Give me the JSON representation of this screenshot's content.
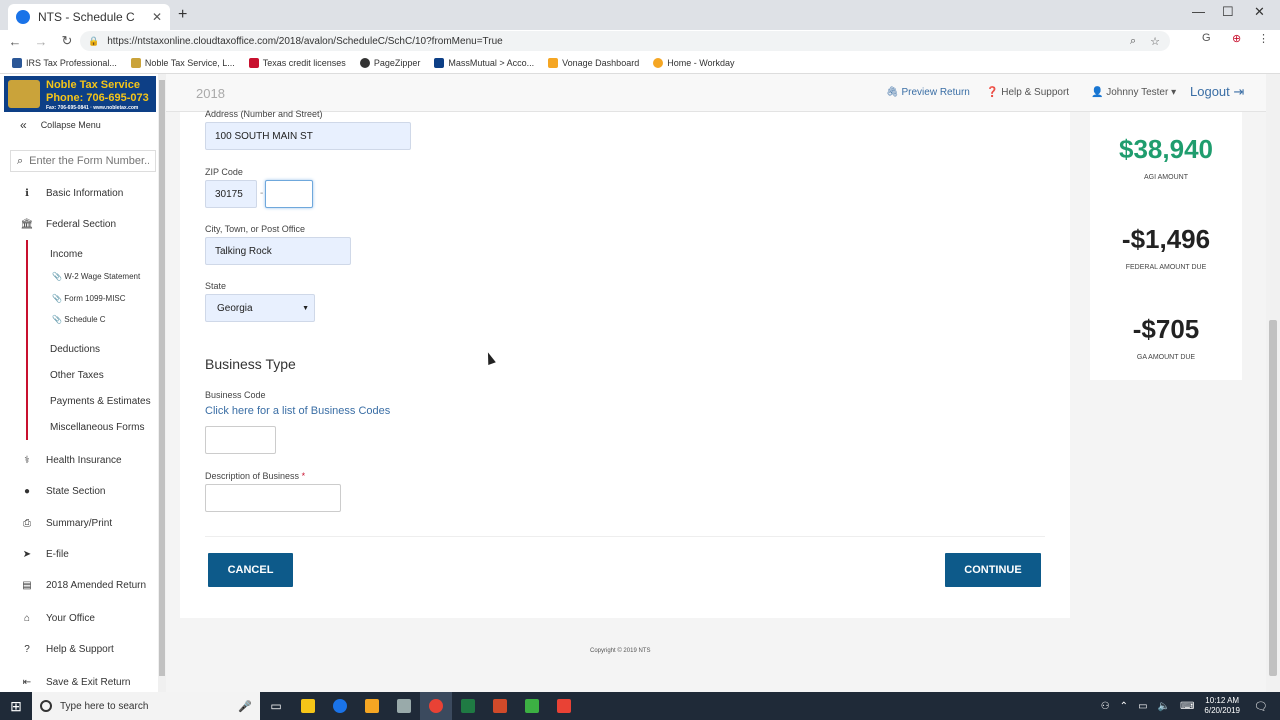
{
  "browser": {
    "tab_title": "NTS - Schedule C",
    "url": "https://ntstaxonline.cloudtaxoffice.com/2018/avalon/ScheduleC/SchC/10?fromMenu=True",
    "bookmarks": [
      {
        "label": "IRS Tax Professional...",
        "color": "#2b5797"
      },
      {
        "label": "Noble Tax Service, L...",
        "color": "#caa33a"
      },
      {
        "label": "Texas credit licenses",
        "color": "#c8102e"
      },
      {
        "label": "PageZipper",
        "color": "#333333"
      },
      {
        "label": "MassMutual > Acco...",
        "color": "#0d3f86"
      },
      {
        "label": "Vonage Dashboard",
        "color": "#f5a623"
      },
      {
        "label": "Home - Workday",
        "color": "#f5a623"
      }
    ]
  },
  "logo": {
    "name": "Noble Tax Service",
    "phone": "Phone: 706-695-073",
    "fax": "Fax: 706-695-0841 · www.nobletax.com"
  },
  "sidebar": {
    "collapse_label": "Collapse Menu",
    "search_placeholder": "Enter the Form Number...",
    "items": [
      {
        "label": "Basic Information",
        "icon": "info-icon"
      },
      {
        "label": "Federal Section",
        "icon": "bank-icon"
      },
      {
        "label": "Health Insurance",
        "icon": "stethoscope-icon"
      },
      {
        "label": "State Section",
        "icon": "map-marker-icon"
      },
      {
        "label": "Summary/Print",
        "icon": "printer-icon"
      },
      {
        "label": "E-file",
        "icon": "send-icon"
      },
      {
        "label": "2018 Amended Return",
        "icon": "document-icon"
      },
      {
        "label": "Your Office",
        "icon": "home-icon"
      },
      {
        "label": "Help & Support",
        "icon": "question-icon"
      },
      {
        "label": "Save & Exit Return",
        "icon": "exit-icon"
      }
    ],
    "federal_sub": {
      "income": "Income",
      "income_forms": [
        "W-2 Wage Statement",
        "Form 1099-MISC",
        "Schedule C"
      ],
      "others": [
        "Deductions",
        "Other Taxes",
        "Payments & Estimates",
        "Miscellaneous Forms"
      ]
    }
  },
  "header": {
    "year": "2018",
    "preview_return": "Preview Return",
    "help_support": "Help & Support",
    "user": "Johnny Tester",
    "logout": "Logout"
  },
  "form": {
    "address_label": "Address (Number and Street)",
    "address_value": "100 SOUTH MAIN ST",
    "zip_label": "ZIP Code",
    "zip_value": "30175",
    "zip_ext_value": "",
    "city_label": "City, Town, or Post Office",
    "city_value": "Talking Rock",
    "state_label": "State",
    "state_value": "Georgia",
    "business_type_title": "Business Type",
    "business_code_label": "Business Code",
    "business_code_link": "Click here for a list of Business Codes",
    "business_code_value": "",
    "description_label": "Description of Business",
    "description_value": "",
    "cancel_label": "CANCEL",
    "continue_label": "CONTINUE"
  },
  "summary": {
    "agi_amount": "$38,940",
    "agi_label": "AGI AMOUNT",
    "federal_amount": "-$1,496",
    "federal_label": "FEDERAL AMOUNT DUE",
    "ga_amount": "-$705",
    "ga_label": "GA AMOUNT DUE"
  },
  "footer": {
    "copyright": "Copyright © 2019 NTS"
  },
  "taskbar": {
    "search_placeholder": "Type here to search",
    "time": "10:12 AM",
    "date": "6/20/2019"
  }
}
